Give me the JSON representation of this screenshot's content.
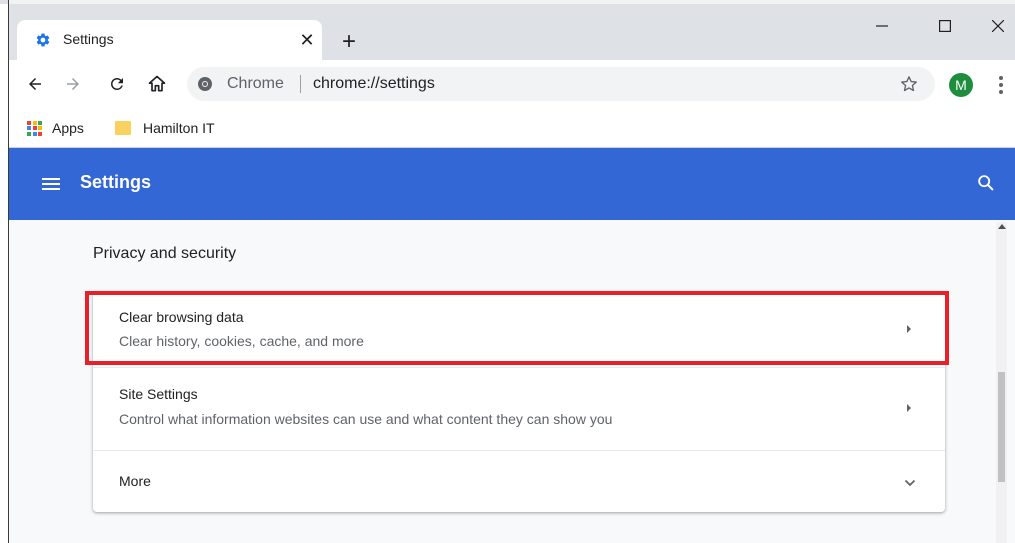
{
  "tab": {
    "title": "Settings",
    "close_glyph": "✕",
    "new_tab_glyph": "+"
  },
  "window_controls": {
    "minimize": "—",
    "maximize": "☐",
    "close": "✕"
  },
  "omnibox": {
    "chip": "Chrome",
    "url": "chrome://settings"
  },
  "profile": {
    "initial": "M",
    "color": "#1e8e3e"
  },
  "bookmarks": [
    {
      "label": "Apps",
      "icon": "apps-grid-icon"
    },
    {
      "label": "Hamilton IT",
      "icon": "folder-icon"
    }
  ],
  "header": {
    "title": "Settings",
    "bg_color": "#3367d6"
  },
  "section": {
    "title": "Privacy and security"
  },
  "rows": [
    {
      "title": "Clear browsing data",
      "subtitle": "Clear history, cookies, cache, and more",
      "icon": "chevron-right-icon",
      "highlighted": true
    },
    {
      "title": "Site Settings",
      "subtitle": "Control what information websites can use and what content they can show you",
      "icon": "chevron-right-icon"
    },
    {
      "title": "More",
      "icon": "chevron-down-icon"
    }
  ],
  "colors": {
    "highlight": "#e8202a",
    "accent": "#3367d6"
  }
}
